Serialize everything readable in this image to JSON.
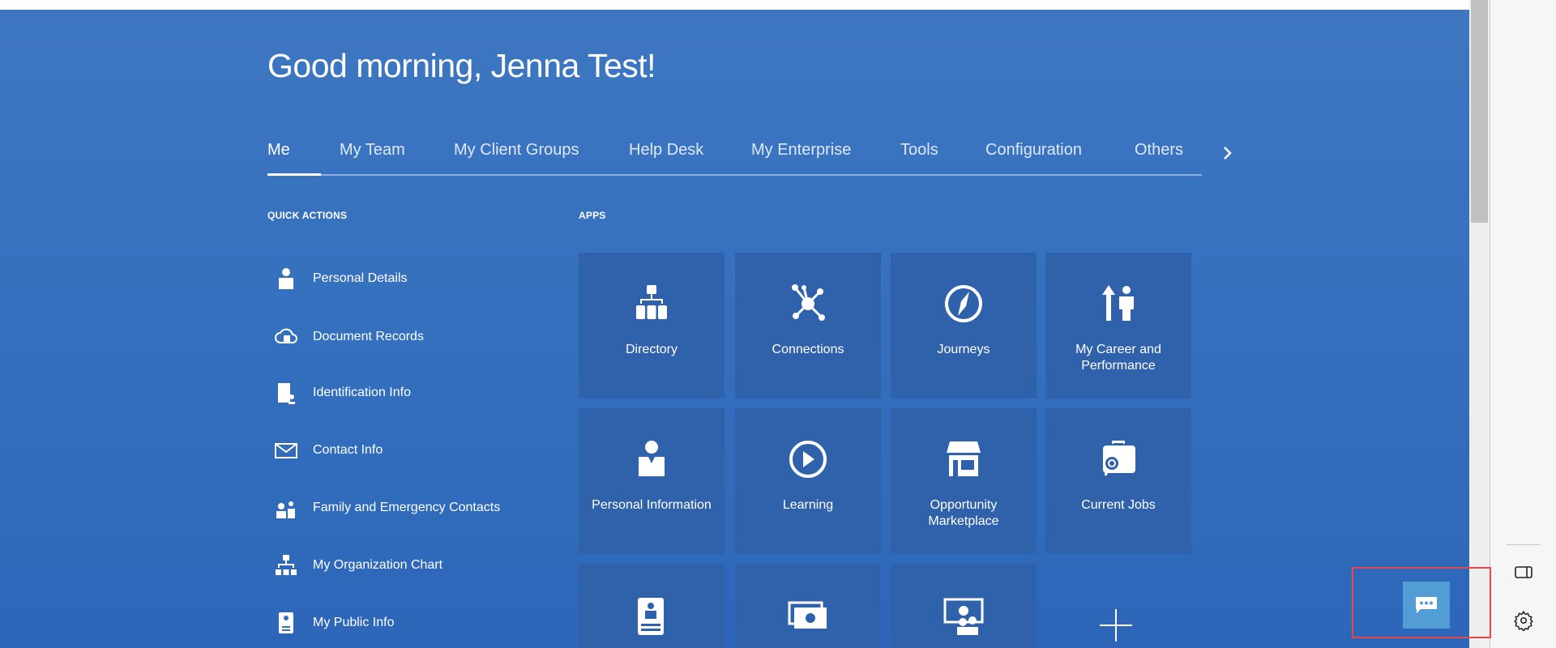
{
  "greeting": "Good morning, Jenna Test!",
  "tabs": [
    "Me",
    "My Team",
    "My Client Groups",
    "Help Desk",
    "My Enterprise",
    "Tools",
    "Configuration",
    "Others"
  ],
  "quick_actions": {
    "title": "QUICK ACTIONS",
    "items": [
      "Personal Details",
      "Document Records",
      "Identification Info",
      "Contact Info",
      "Family and Emergency Contacts",
      "My Organization Chart",
      "My Public Info"
    ]
  },
  "apps": {
    "title": "APPS",
    "tiles": [
      "Directory",
      "Connections",
      "Journeys",
      "My Career and Performance",
      "Personal Information",
      "Learning",
      "Opportunity Marketplace",
      "Current Jobs"
    ]
  },
  "colors": {
    "accent": "#3470be",
    "tile": "#2f62ab",
    "chat": "#539dd6",
    "highlight": "#e5484d"
  }
}
